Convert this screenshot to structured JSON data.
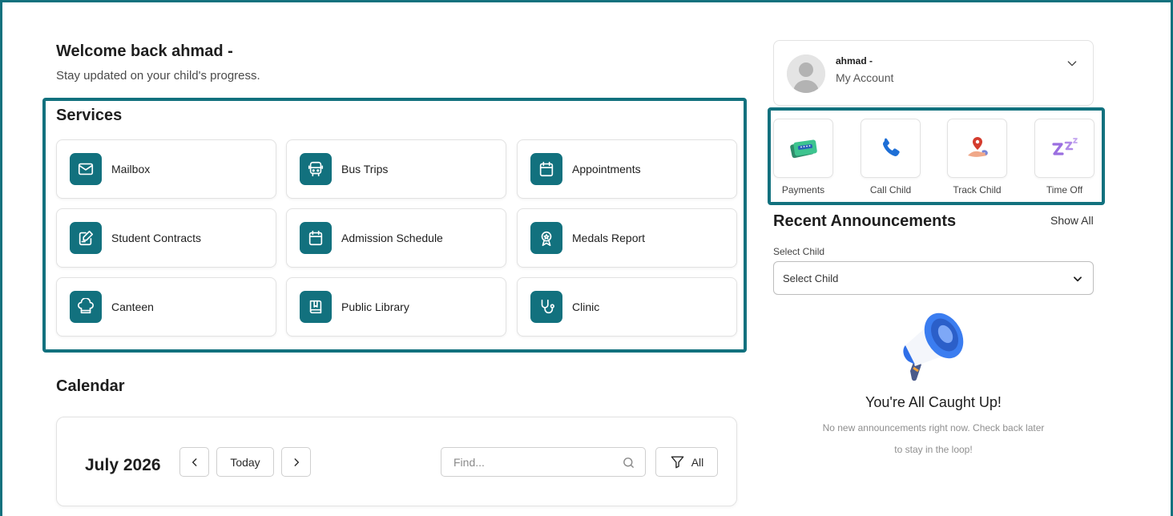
{
  "header": {
    "welcome": "Welcome back ahmad -",
    "subtitle": "Stay updated on your child's progress."
  },
  "services": {
    "title": "Services",
    "items": [
      {
        "label": "Mailbox",
        "icon": "mail-icon"
      },
      {
        "label": "Bus Trips",
        "icon": "bus-icon"
      },
      {
        "label": "Appointments",
        "icon": "calendar-icon"
      },
      {
        "label": "Student Contracts",
        "icon": "contract-edit-icon"
      },
      {
        "label": "Admission Schedule",
        "icon": "calendar-icon"
      },
      {
        "label": "Medals Report",
        "icon": "medal-icon"
      },
      {
        "label": "Canteen",
        "icon": "chef-hat-icon"
      },
      {
        "label": "Public Library",
        "icon": "book-icon"
      },
      {
        "label": "Clinic",
        "icon": "stethoscope-icon"
      }
    ]
  },
  "calendar": {
    "title": "Calendar",
    "month": "July 2026",
    "today": "Today",
    "prev": "‹",
    "next": "›",
    "find_placeholder": "Find...",
    "filter_label": "All"
  },
  "account": {
    "name": "ahmad -",
    "label": "My Account"
  },
  "quick_actions": [
    {
      "label": "Payments",
      "icon": "credit-card-icon"
    },
    {
      "label": "Call Child",
      "icon": "phone-icon"
    },
    {
      "label": "Track Child",
      "icon": "location-pin-icon"
    },
    {
      "label": "Time Off",
      "icon": "sleep-zzz-icon"
    }
  ],
  "announcements": {
    "title": "Recent Announcements",
    "show_all": "Show All",
    "select_label": "Select Child",
    "select_value": "Select Child",
    "empty_title": "You're All Caught Up!",
    "empty_text": "No new announcements right now. Check back later to stay in the loop!"
  },
  "colors": {
    "brand": "#12717e",
    "card_border": "#e2e2e2"
  }
}
